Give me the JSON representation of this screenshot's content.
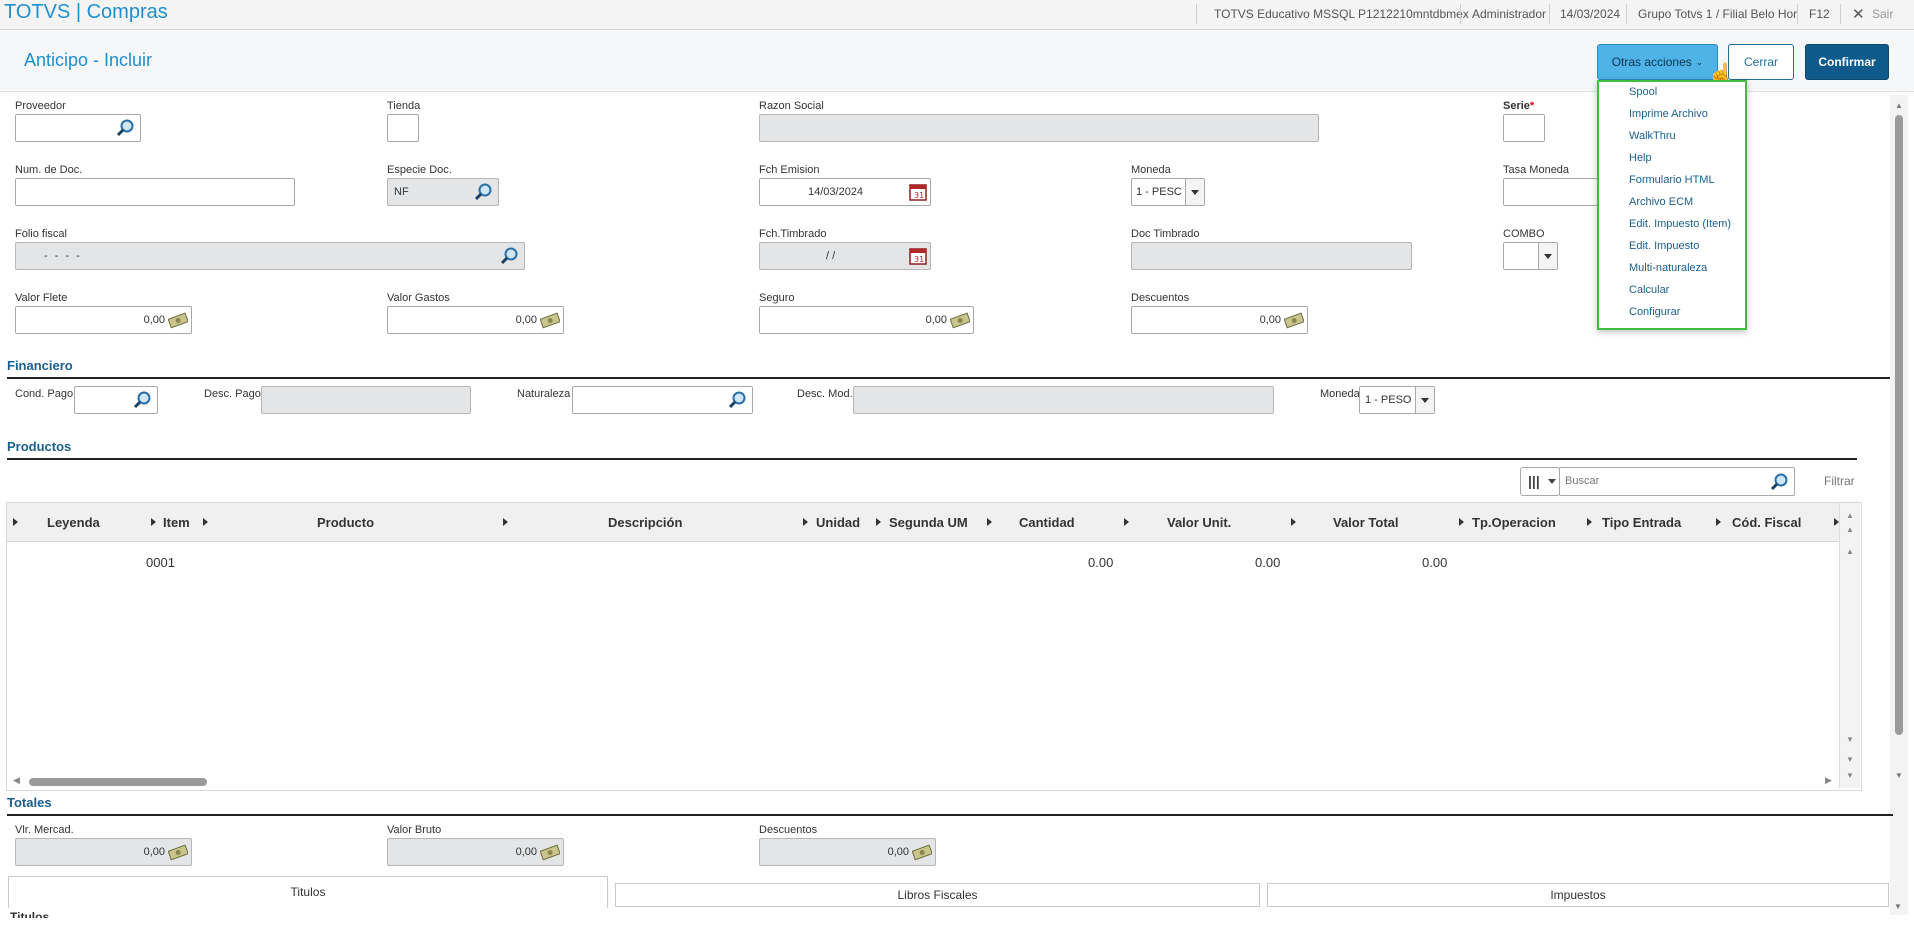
{
  "topbar": {
    "app_title": "TOTVS | Compras",
    "environment": "TOTVS Educativo MSSQL P1212210mntdbmex",
    "user": "Administrador",
    "date": "14/03/2024",
    "branch": "Grupo Totvs 1 / Filial Belo Hor",
    "help_key": "F12",
    "exit_label": "Sair"
  },
  "header": {
    "title": "Anticipo - Incluir",
    "otras_acciones": "Otras acciones",
    "cerrar": "Cerrar",
    "confirmar": "Confirmar"
  },
  "menu": {
    "items": [
      "Spool",
      "Imprime Archivo",
      "WalkThru",
      "Help",
      "Formulario HTML",
      "Archivo ECM",
      "Edit. Impuesto (Item)",
      "Edit. Impuesto",
      "Multi-naturaleza",
      "Calcular",
      "Configurar"
    ]
  },
  "form": {
    "proveedor": "Proveedor",
    "tienda": "Tienda",
    "razon_social": "Razon Social",
    "serie": "Serie",
    "serie_req": "*",
    "num_doc": "Num. de Doc.",
    "especie_doc": "Especie Doc.",
    "especie_doc_value": "NF",
    "fch_emision": "Fch Emision",
    "fch_emision_value": "14/03/2024",
    "moneda": "Moneda",
    "moneda_value": "1 - PESC",
    "tasa_moneda": "Tasa Moneda",
    "folio_fiscal": "Folio fiscal",
    "folio_fiscal_value": "- - - -",
    "fch_timbrado": "Fch.Timbrado",
    "fch_timbrado_value": "/ /",
    "doc_timbrado": "Doc Timbrado",
    "combo": "COMBO",
    "valor_flete": "Valor Flete",
    "valor_flete_value": "0,00",
    "valor_gastos": "Valor Gastos",
    "valor_gastos_value": "0,00",
    "seguro": "Seguro",
    "seguro_value": "0,00",
    "descuentos": "Descuentos",
    "descuentos_value": "0,00"
  },
  "financiero": {
    "title": "Financiero",
    "cond_pago": "Cond. Pago",
    "desc_pago": "Desc. Pago",
    "naturaleza": "Naturaleza",
    "desc_mod": "Desc. Mod.",
    "moneda": "Moneda",
    "moneda_value": "1 - PESO"
  },
  "productos": {
    "title": "Productos",
    "search_placeholder": "Buscar",
    "filter": "Filtrar",
    "columns": [
      "Leyenda",
      "Item",
      "Producto",
      "Descripción",
      "Unidad",
      "Segunda UM",
      "Cantidad",
      "Valor Unit.",
      "Valor Total",
      "Tp.Operacion",
      "Tipo Entrada",
      "Cód. Fiscal"
    ],
    "rows": [
      {
        "item": "0001",
        "cantidad": "0.00",
        "valor_unit": "0.00",
        "valor_total": "0.00"
      }
    ]
  },
  "totales": {
    "title": "Totales",
    "vlr_mercad": "Vlr. Mercad.",
    "vlr_mercad_value": "0,00",
    "valor_bruto": "Valor Bruto",
    "valor_bruto_value": "0,00",
    "descuentos": "Descuentos",
    "descuentos_value": "0,00"
  },
  "tabs": [
    "Titulos",
    "Libros Fiscales",
    "Impuestos"
  ],
  "bottom_label": "Titulos"
}
